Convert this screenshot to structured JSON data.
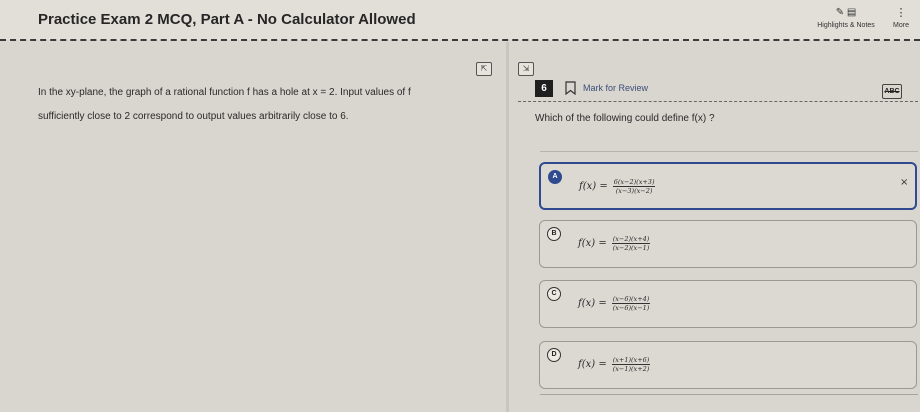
{
  "header": {
    "title": "Practice Exam 2 MCQ, Part A - No Calculator Allowed",
    "highlights_icons": "✎ ▤",
    "highlights_label": "Highlights & Notes",
    "more_icon": "⋮",
    "more_label": "More"
  },
  "split_controls": {
    "expand_left": "⇱",
    "expand_right": "⇲"
  },
  "passage": {
    "line1": "In the xy-plane, the graph of a rational function f has a hole at x = 2. Input values of f",
    "line2": "sufficiently close to 2 correspond to output values arbitrarily close to 6."
  },
  "question": {
    "number": "6",
    "mark_label": "Mark for Review",
    "abc_label": "ABC",
    "stem": "Which of the following could define f(x) ?"
  },
  "choices": [
    {
      "letter": "A",
      "lhs": "f(x) =",
      "num": "6(x−2)(x+3)",
      "den": "(x−3)(x−2)",
      "selected": true,
      "close": "×"
    },
    {
      "letter": "B",
      "lhs": "f(x) =",
      "num": "(x−2)(x+4)",
      "den": "(x−2)(x−1)",
      "selected": false
    },
    {
      "letter": "C",
      "lhs": "f(x) =",
      "num": "(x−6)(x+4)",
      "den": "(x−6)(x−1)",
      "selected": false
    },
    {
      "letter": "D",
      "lhs": "f(x) =",
      "num": "(x+1)(x+6)",
      "den": "(x−1)(x+2)",
      "selected": false
    }
  ],
  "colors": {
    "accent": "#2f4a8e",
    "background": "#d9d5cf"
  }
}
